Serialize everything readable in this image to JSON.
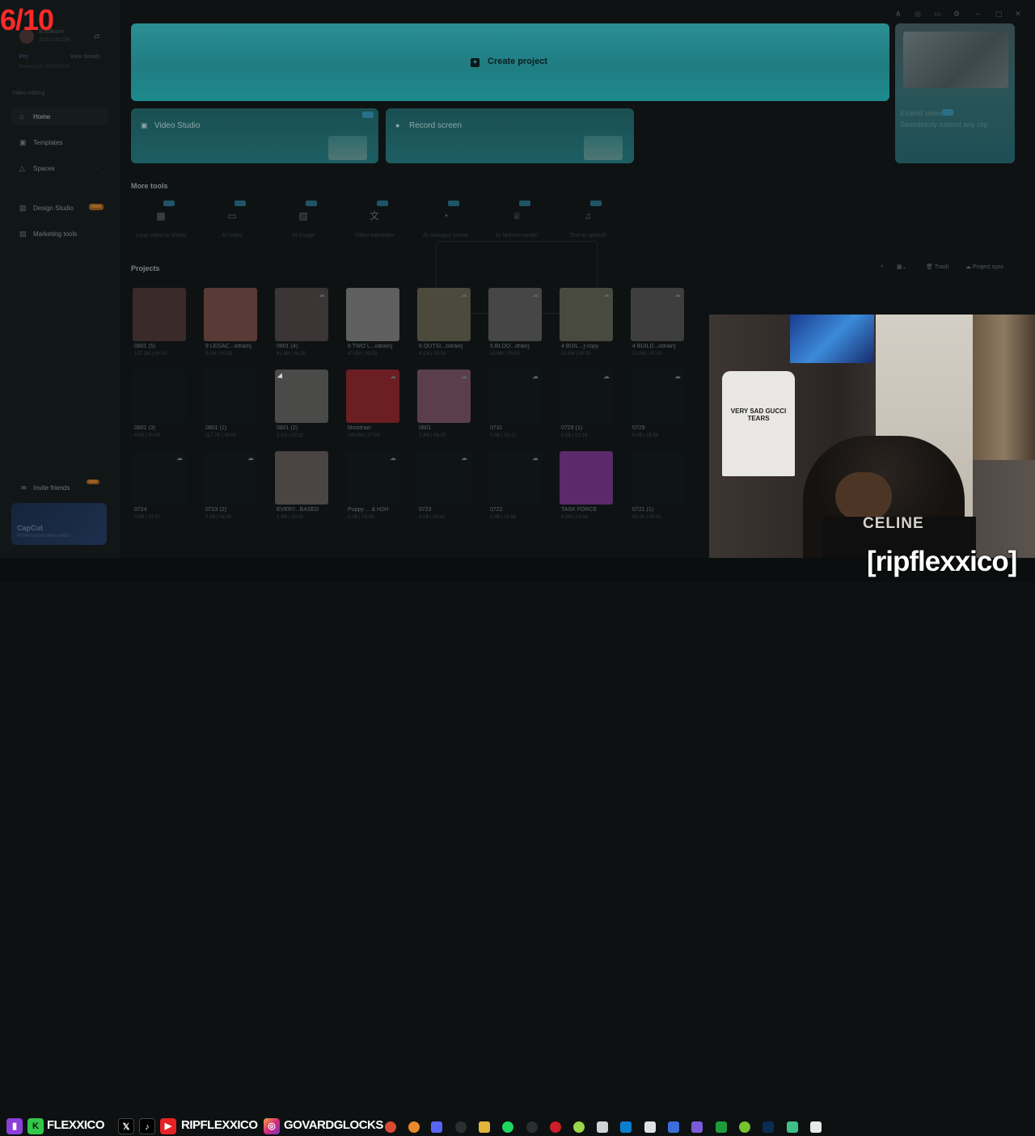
{
  "overlay": {
    "counter": "6/10",
    "handle": "[ripflexxico]"
  },
  "sidebar": {
    "account": {
      "name": "lk3stlkumi",
      "id": "3163140238",
      "switch_icon": "swap-icon"
    },
    "pro": {
      "label": "Pro",
      "view_details": "View details"
    },
    "renew": "Renews on 09/08/2024",
    "section_label": "Video editing",
    "items": [
      {
        "label": "Home",
        "icon": "home-icon"
      },
      {
        "label": "Templates",
        "icon": "templates-icon"
      },
      {
        "label": "Spaces",
        "icon": "spaces-icon"
      },
      {
        "label": "Design Studio",
        "icon": "design-icon",
        "badge": "New"
      },
      {
        "label": "Marketing tools",
        "icon": "marketing-icon"
      }
    ],
    "invite": {
      "label": "Invite friends",
      "badge": "New"
    },
    "capcut_card": {
      "title": "CapCut",
      "subtitle": "Professional video editor"
    }
  },
  "hero": {
    "create_label": "Create project"
  },
  "tiles": [
    {
      "label": "Video Studio"
    },
    {
      "label": "Record screen"
    }
  ],
  "promo": {
    "title": "Extend video",
    "subtitle": "Seamlessly extend any clip"
  },
  "more_tools": {
    "heading": "More tools",
    "items": [
      {
        "label": "Long video to shorts",
        "icon": "long-video-icon"
      },
      {
        "label": "AI video",
        "icon": "ai-video-icon"
      },
      {
        "label": "AI image",
        "icon": "ai-image-icon"
      },
      {
        "label": "Video translator",
        "icon": "translate-icon"
      },
      {
        "label": "AI dialogue scene",
        "icon": "dialogue-icon"
      },
      {
        "label": "AI fashion model",
        "icon": "fashion-icon"
      },
      {
        "label": "Text to speech",
        "icon": "tts-icon"
      }
    ]
  },
  "projects": {
    "heading": "Projects",
    "toolbar": {
      "trash": "Trash",
      "sync": "Project sync"
    },
    "items": [
      {
        "name": "0801 (5)",
        "meta": "107.2M | 00:59",
        "color": "#3a2a2a",
        "cloud": false
      },
      {
        "name": "9 LEGAC...odrain]",
        "meta": "5.0M | 00:59",
        "color": "#5a3a36",
        "cloud": false
      },
      {
        "name": "0801 (4)",
        "meta": "41.4M | 01:50",
        "color": "#3b3535",
        "cloud": true
      },
      {
        "name": "8 TWO L...odrain]",
        "meta": "47.9M | 00:59",
        "color": "#5f5f5f",
        "cloud": false
      },
      {
        "name": "6 OUTSI...odrain]",
        "meta": "6.1M | 00:59",
        "color": "#4c4a3c",
        "cloud": true
      },
      {
        "name": "5 BLOO...drain]",
        "meta": "10.6M | 00:59",
        "color": "#464646",
        "cloud": true
      },
      {
        "name": "4 BUIL...]-copy",
        "meta": "10.6M | 00:59",
        "color": "#484a40",
        "cloud": true
      },
      {
        "name": "4 BUILD...odrain]",
        "meta": "10.6M | 00:59",
        "color": "#3e3e3e",
        "cloud": true
      },
      {
        "name": "0801 (3)",
        "meta": "4.6K | 00:00",
        "color": "#0f1415",
        "cloud": false
      },
      {
        "name": "0801 (1)",
        "meta": "117.7K | 00:00",
        "color": "#0f1415",
        "cloud": false
      },
      {
        "name": "0801 (2)",
        "meta": "3.1M | 02:32",
        "color": "#4a4a48",
        "cloud": false
      },
      {
        "name": "bloodrain",
        "meta": "145.8M | 07:54",
        "color": "#6b1f22",
        "cloud": true
      },
      {
        "name": "0801",
        "meta": "3.3M | 04:25",
        "color": "#5a3f4a",
        "cloud": true
      },
      {
        "name": "0731",
        "meta": "0.0B | 03:11",
        "color": "#0f1415",
        "cloud": true
      },
      {
        "name": "0729 (1)",
        "meta": "0.0B | 02:18",
        "color": "#0f1415",
        "cloud": true
      },
      {
        "name": "0729",
        "meta": "0.0B | 05:58",
        "color": "#0f1415",
        "cloud": true
      },
      {
        "name": "0724",
        "meta": "0.0B | 03:57",
        "color": "#0f1415",
        "cloud": true
      },
      {
        "name": "0723 (2)",
        "meta": "0.0B | 04:40",
        "color": "#0f1415",
        "cloud": true
      },
      {
        "name": "EVERY...BASED",
        "meta": "1.4M | 00:59",
        "color": "#4a4543",
        "cloud": false
      },
      {
        "name": "Puppy ... & H2H",
        "meta": "0.0B | 05:04",
        "color": "#0f1415",
        "cloud": true
      },
      {
        "name": "0723",
        "meta": "0.0B | 04:40",
        "color": "#0f1415",
        "cloud": true
      },
      {
        "name": "0722",
        "meta": "0.0B | 05:58",
        "color": "#0f1415",
        "cloud": true
      },
      {
        "name": "TASK FORCE",
        "meta": "6.0M | 00:59",
        "color": "#5a2a6a",
        "cloud": false
      },
      {
        "name": "0721 (1)",
        "meta": "69.0K | 00:00",
        "color": "#0f1415",
        "cloud": false
      }
    ]
  },
  "social": [
    {
      "icon": "twitch-icon",
      "label": ""
    },
    {
      "icon": "kick-icon",
      "label": "FLEXXICO"
    },
    {
      "icon": "x-icon",
      "label": ""
    },
    {
      "icon": "tiktok-icon",
      "label": ""
    },
    {
      "icon": "youtube-icon",
      "label": "RIPFLEXXICO"
    },
    {
      "icon": "instagram-icon",
      "label": "GOVARDGLOCKS"
    }
  ],
  "webcam": {
    "shirt_text": "VERY SAD GUCCI TEARS",
    "shirt2_text": "CELINE"
  },
  "colors": {
    "hero": "#2a8f94",
    "counter": "#ff2a2a",
    "accent": "#1d5e62"
  }
}
